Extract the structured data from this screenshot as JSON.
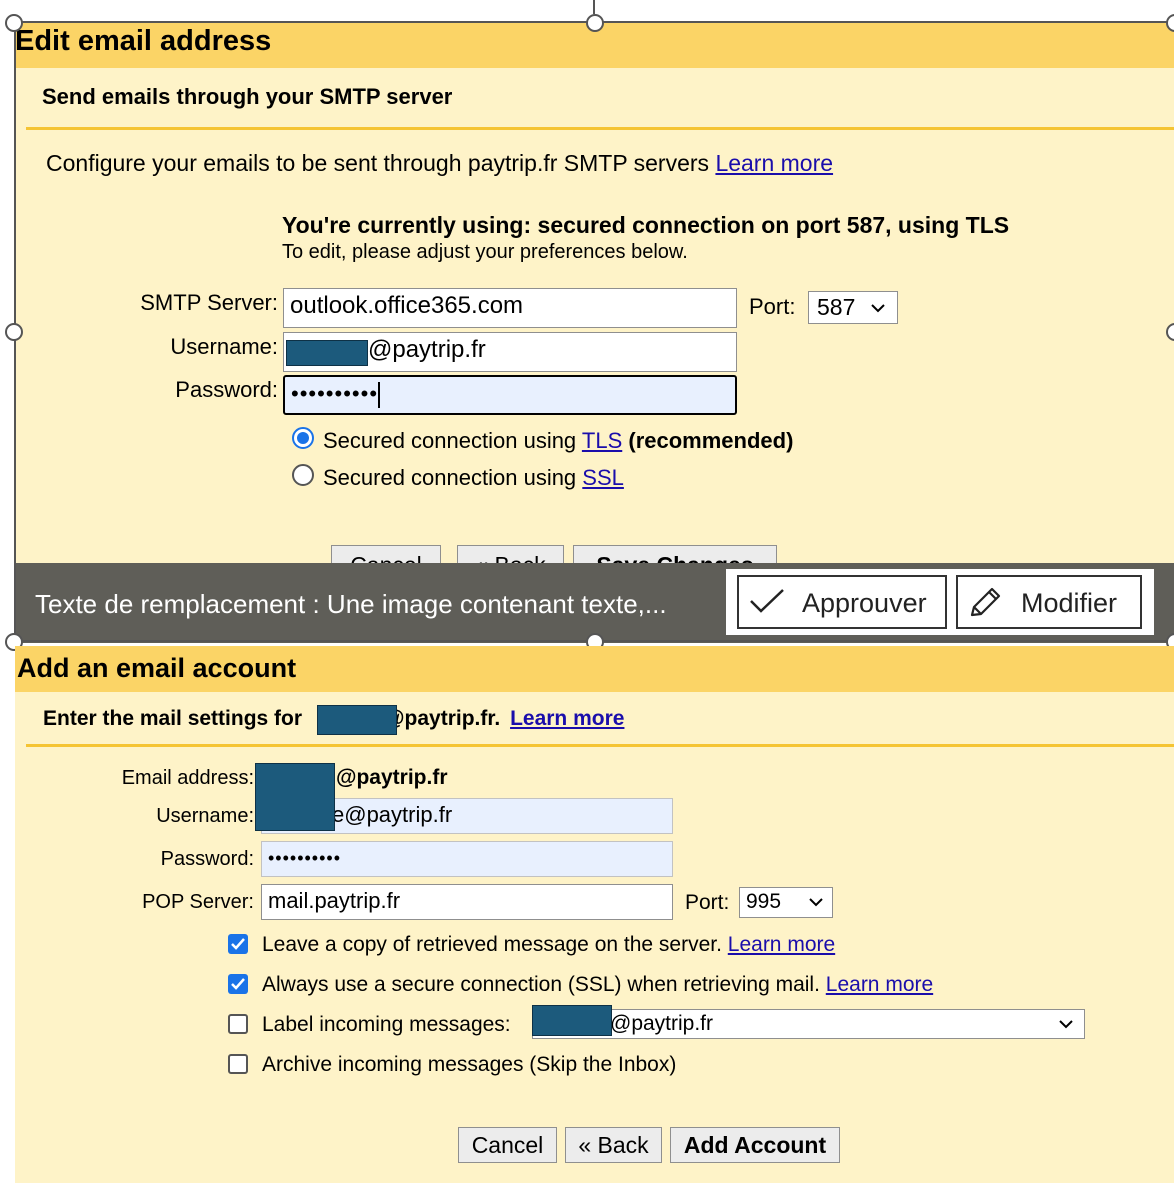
{
  "edit_panel": {
    "title": "Edit email address",
    "subtitle": "Send emails through your SMTP server",
    "configure_text": "Configure your emails to be sent through paytrip.fr SMTP servers",
    "learn_more": "Learn more",
    "currently_using": "You're currently using: secured connection on port 587, using TLS",
    "edit_hint": "To edit, please adjust your preferences below.",
    "smtp_label": "SMTP Server:",
    "smtp_value": "outlook.office365.com",
    "port_label": "Port:",
    "port_value": "587",
    "username_label": "Username:",
    "username_suffix": "@paytrip.fr",
    "password_label": "Password:",
    "password_value": "••••••••••",
    "tls_option": "Secured connection using",
    "tls_link": "TLS",
    "tls_recommended": "(recommended)",
    "ssl_option": "Secured connection using",
    "ssl_link": "SSL",
    "cancel": "Cancel",
    "back": "« Back",
    "save": "Save Changes"
  },
  "overlay": {
    "alt_text": "Texte de remplacement : Une image contenant texte,...",
    "approve": "Approuver",
    "modify": "Modifier"
  },
  "add_panel": {
    "title": "Add an email account",
    "subtitle_prefix": "Enter the mail settings for",
    "subtitle_suffix": "@paytrip.fr.",
    "learn_more": "Learn more",
    "email_label": "Email address:",
    "email_suffix": "@paytrip.fr",
    "username_label": "Username:",
    "username_suffix": "e@paytrip.fr",
    "password_label": "Password:",
    "password_value": "••••••••••",
    "pop_label": "POP Server:",
    "pop_value": "mail.paytrip.fr",
    "port_label": "Port:",
    "port_value": "995",
    "opt_leave_copy": "Leave a copy of retrieved message on the server.",
    "opt_ssl": "Always use a secure connection (SSL) when retrieving mail.",
    "opt_label": "Label incoming messages:",
    "label_value_suffix": "@paytrip.fr",
    "opt_archive": "Archive incoming messages (Skip the Inbox)",
    "learn_more_1": "Learn more",
    "learn_more_2": "Learn more",
    "cancel": "Cancel",
    "back": "« Back",
    "add_account": "Add Account"
  },
  "colors": {
    "panel_bg": "#fef3c8",
    "band": "#fbd466",
    "link": "#1a0dab",
    "checkbox": "#1a73e8",
    "redaction": "#1c5a7c",
    "overlay": "#5f5e58"
  }
}
